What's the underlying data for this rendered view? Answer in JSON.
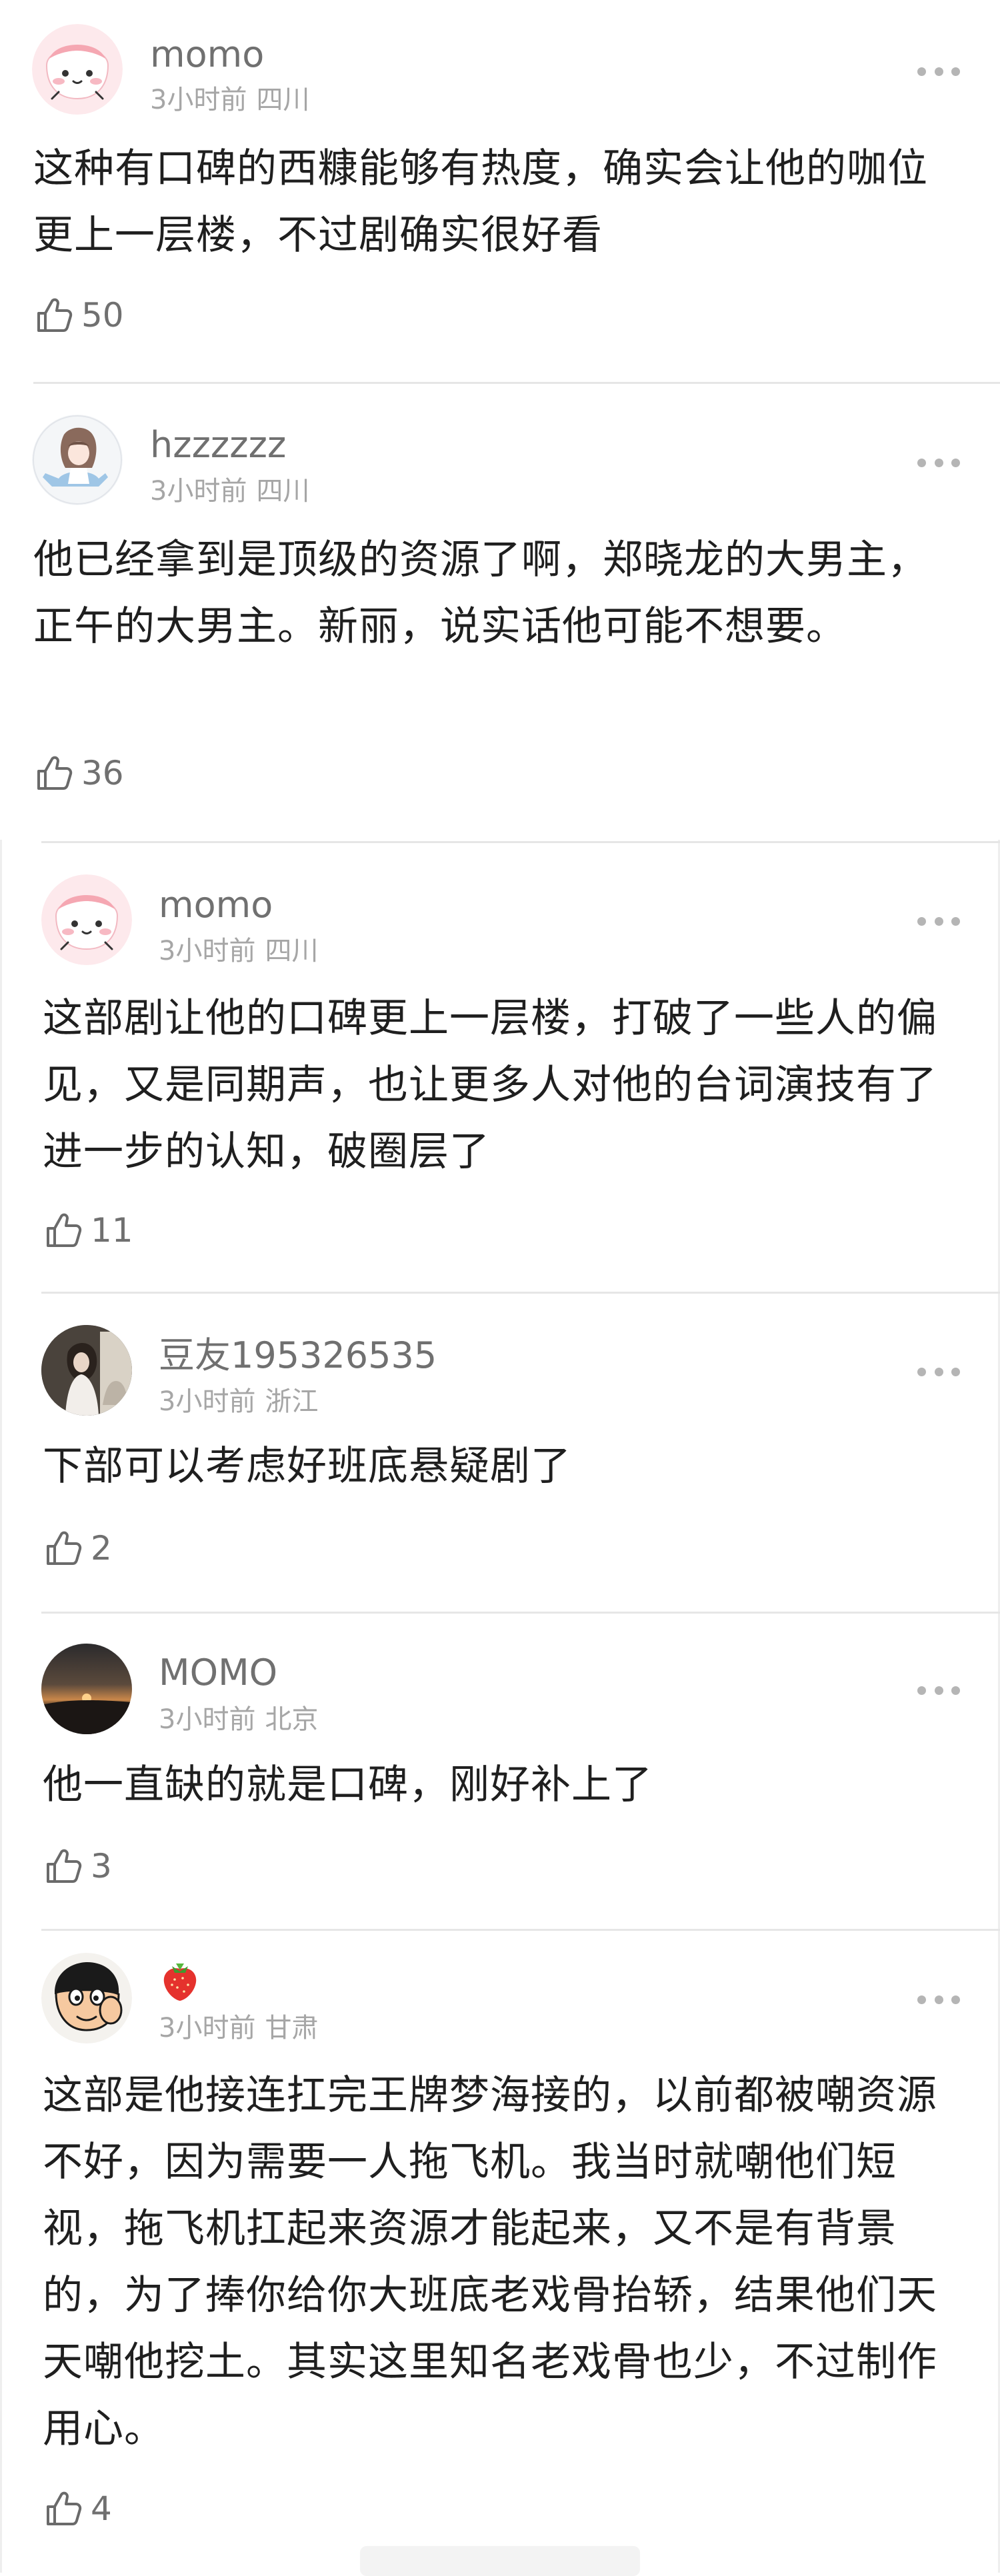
{
  "comments": [
    {
      "username": "momo",
      "time": "3小时前",
      "location": "四川",
      "text": "这种有口碑的西糠能够有热度，确实会让他的咖位更上一层楼，不过剧确实很好看",
      "likes": "50",
      "avatar": "pink-blob-avatar"
    },
    {
      "username": "hzzzzzz",
      "time": "3小时前",
      "location": "四川",
      "text": "他已经拿到是顶级的资源了啊，郑晓龙的大男主，正午的大男主。新丽，说实话他可能不想要。",
      "likes": "36",
      "avatar": "anime-girl-avatar"
    },
    {
      "username": "momo",
      "time": "3小时前",
      "location": "四川",
      "text": "这部剧让他的口碑更上一层楼，打破了一些人的偏见，又是同期声，也让更多人对他的台词演技有了进一步的认知，破圈层了",
      "likes": "11",
      "avatar": "pink-blob-avatar"
    },
    {
      "username": "豆友195326535",
      "time": "3小时前",
      "location": "浙江",
      "text": "下部可以考虑好班底悬疑剧了",
      "likes": "2",
      "avatar": "photo-avatar"
    },
    {
      "username": "MOMO",
      "time": "3小时前",
      "location": "北京",
      "text": "他一直缺的就是口碑，刚好补上了",
      "likes": "3",
      "avatar": "sunset-avatar"
    },
    {
      "username": "",
      "username_icon": "strawberry-icon",
      "time": "3小时前",
      "location": "甘肃",
      "text": "这部是他接连扛完王牌梦海接的，以前都被嘲资源不好，因为需要一人拖飞机。我当时就嘲他们短视，拖飞机扛起来资源才能起来，又不是有背景的，为了捧你给你大班底老戏骨抬轿，结果他们天天嘲他挖土。其实这里知名老戏骨也少，不过制作用心。",
      "likes": "4",
      "avatar": "cartoon-boy-avatar"
    }
  ],
  "colors": {
    "username": "#707070",
    "meta": "#a6a6a6",
    "text": "#1f1f1f",
    "divider": "#e6e6e6",
    "more_dots": "#b5b5b5"
  }
}
